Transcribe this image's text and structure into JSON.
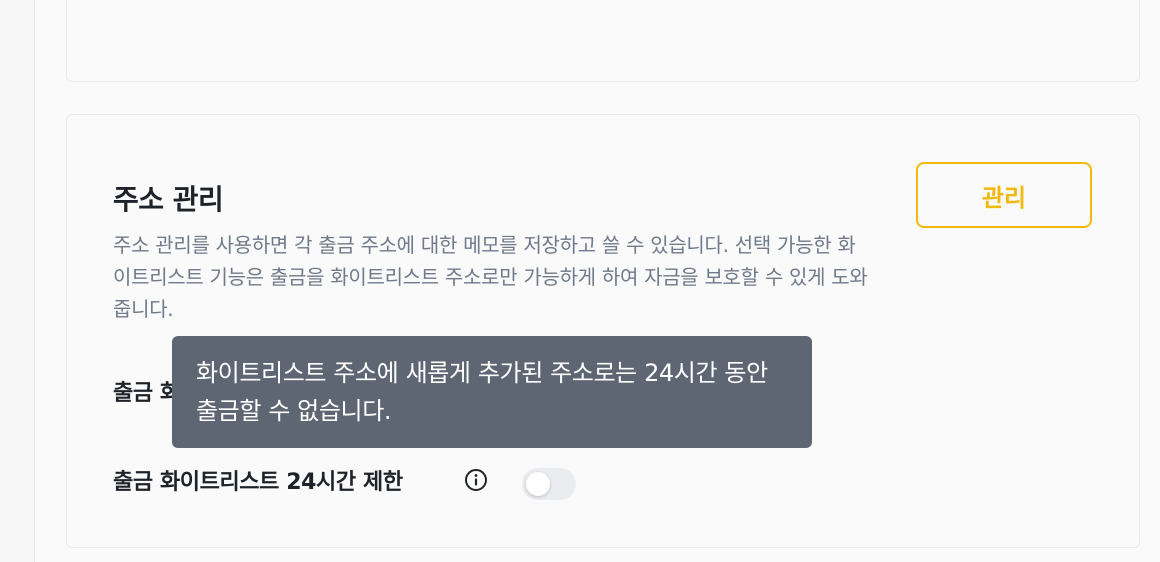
{
  "address_management": {
    "title": "주소 관리",
    "description": "주소 관리를 사용하면 각 출금 주소에 대한 메모를 저장하고 쓸 수 있습니다. 선택 가능한 화이트리스트 기능은 출금을 화이트리스트 주소로만 가능하게 하여 자금을 보호할 수 있게 도와줍니다.",
    "manage_button": "관리"
  },
  "settings": {
    "row1_label": "출금 화",
    "row2_label": "출금 화이트리스트 24시간 제한",
    "row2_toggle_on": false
  },
  "tooltip": {
    "text": "화이트리스트 주소에 새롭게 추가된 주소로는 24시간 동안 출금할 수 없습니다."
  },
  "colors": {
    "accent": "#f0b90b",
    "tooltip_bg": "#5e6673",
    "title_text": "#1e2329",
    "muted_text": "#707a8a"
  }
}
